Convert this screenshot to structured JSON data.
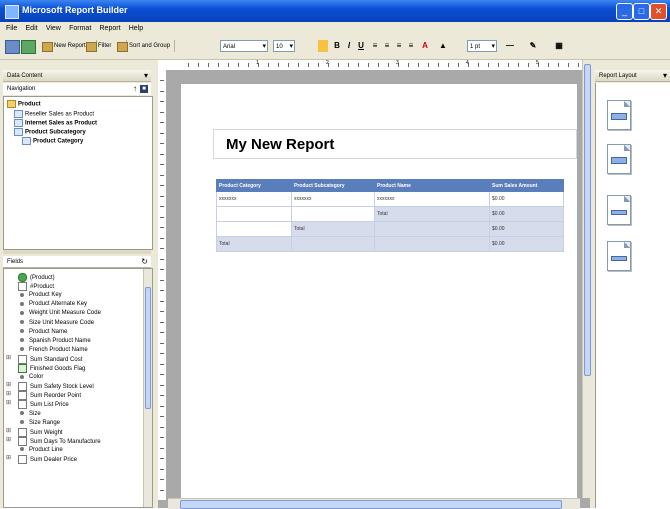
{
  "window": {
    "title": "Microsoft Report Builder",
    "controls": [
      "_",
      "□",
      "✕"
    ]
  },
  "menu": [
    "File",
    "Edit",
    "View",
    "Format",
    "Report",
    "Help"
  ],
  "toolbar": {
    "new_report": "New Report",
    "filter": "Filter",
    "sort_group": "Sort and Group",
    "font": "Arial",
    "font_size": "10",
    "line_width": "1 pt"
  },
  "data_content": {
    "header": "Data Content",
    "navigation_label": "Navigation",
    "tree": [
      {
        "label": "Product",
        "bold": true,
        "level": 0
      },
      {
        "label": "Reseller Sales as Product",
        "bold": false,
        "level": 1
      },
      {
        "label": "Internet Sales as Product",
        "bold": true,
        "level": 1
      },
      {
        "label": "Product Subcategory",
        "bold": true,
        "level": 1
      },
      {
        "label": "Product Category",
        "bold": true,
        "level": 2
      }
    ]
  },
  "fields": {
    "header": "Fields",
    "items": [
      {
        "label": "(Product)",
        "icon": "entity",
        "expand": false
      },
      {
        "label": "#Product",
        "icon": "box",
        "expand": false
      },
      {
        "label": "Product Key",
        "icon": "dot",
        "expand": false
      },
      {
        "label": "Product Alternate Key",
        "icon": "dot",
        "expand": false
      },
      {
        "label": "Weight Unit Measure Code",
        "icon": "dot",
        "expand": false
      },
      {
        "label": "Size Unit Measure Code",
        "icon": "dot",
        "expand": false
      },
      {
        "label": "Product Name",
        "icon": "dot",
        "expand": false
      },
      {
        "label": "Spanish Product Name",
        "icon": "dot",
        "expand": false
      },
      {
        "label": "French Product Name",
        "icon": "dot",
        "expand": false
      },
      {
        "label": "Sum Standard Cost",
        "icon": "box",
        "expand": true
      },
      {
        "label": "Finished Goods Flag",
        "icon": "check",
        "expand": false
      },
      {
        "label": "Color",
        "icon": "dot",
        "expand": false
      },
      {
        "label": "Sum Safety Stock Level",
        "icon": "box",
        "expand": true
      },
      {
        "label": "Sum Reorder Point",
        "icon": "box",
        "expand": true
      },
      {
        "label": "Sum List Price",
        "icon": "box",
        "expand": true
      },
      {
        "label": "Size",
        "icon": "dot",
        "expand": false
      },
      {
        "label": "Size Range",
        "icon": "dot",
        "expand": false
      },
      {
        "label": "Sum Weight",
        "icon": "box",
        "expand": true
      },
      {
        "label": "Sum Days To Manufacture",
        "icon": "box",
        "expand": true
      },
      {
        "label": "Product Line",
        "icon": "dot",
        "expand": false
      },
      {
        "label": "Sum Dealer Price",
        "icon": "box",
        "expand": true
      }
    ]
  },
  "report": {
    "title": "My New Report",
    "columns": [
      "Product Category",
      "Product Subcategory",
      "Product Name",
      "Sum Sales Amount"
    ],
    "rows": [
      [
        "xxxxxxx",
        "xxxxxxx",
        "xxxxxxx",
        "$0.00"
      ],
      [
        "",
        "",
        "Total",
        "$0.00"
      ],
      [
        "",
        "Total",
        "",
        "$0.00"
      ],
      [
        "Total",
        "",
        "",
        "$0.00"
      ]
    ]
  },
  "ruler": [
    "1",
    "2",
    "3",
    "4",
    "5"
  ],
  "report_layout": {
    "header": "Report Layout",
    "options": [
      "table-layout",
      "matrix-layout",
      "chart-layout",
      "list-layout"
    ]
  }
}
